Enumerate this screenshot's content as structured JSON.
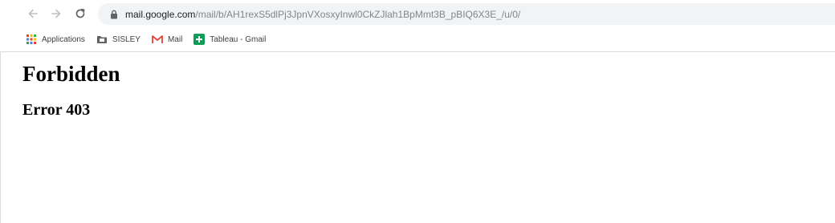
{
  "browser": {
    "url_host": "mail.google.com",
    "url_path": "/mail/b/AH1rexS5dlPj3JpnVXosxyInwl0CkZJlah1BpMmt3B_pBIQ6X3E_/u/0/",
    "icons": {
      "back": "back-arrow-icon",
      "forward": "forward-arrow-icon",
      "reload": "reload-icon",
      "lock": "lock-icon"
    }
  },
  "bookmarks": [
    {
      "label": "Applications",
      "icon": "apps-grid-icon"
    },
    {
      "label": "SISLEY",
      "icon": "folder-icon"
    },
    {
      "label": "Mail",
      "icon": "gmail-icon"
    },
    {
      "label": "Tableau - Gmail",
      "icon": "sheets-icon"
    }
  ],
  "page": {
    "heading": "Forbidden",
    "subheading": "Error 403"
  }
}
